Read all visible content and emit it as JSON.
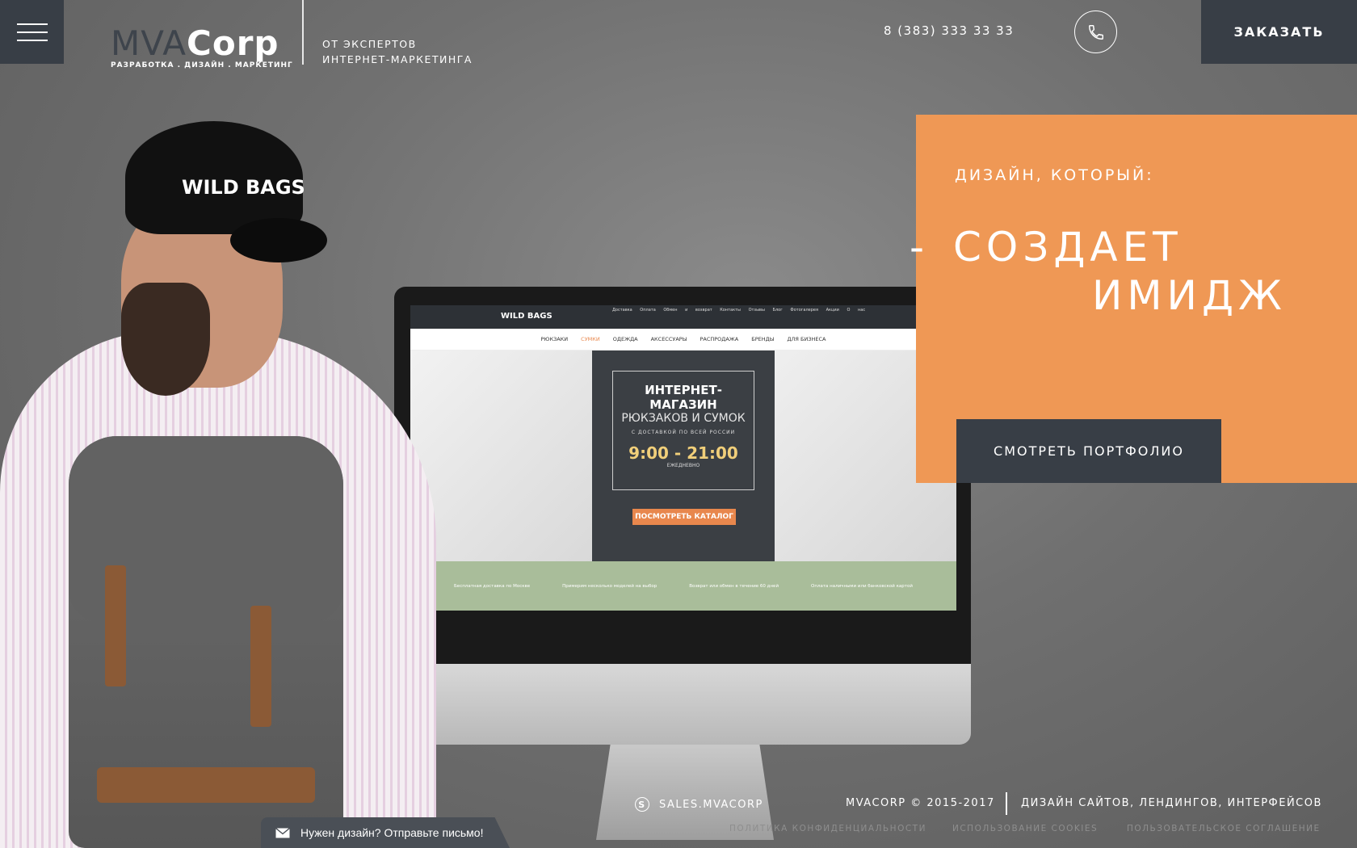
{
  "header": {
    "logo_main_1": "MVA",
    "logo_main_2": "Corp",
    "logo_tagline": "РАЗРАБОТКА . ДИЗАЙН . МАРКЕТИНГ",
    "tagline_line1": "ОТ ЭКСПЕРТОВ",
    "tagline_line2": "ИНТЕРНЕТ-МАРКЕТИНГА",
    "phone": "8 (383) 333 33 33",
    "order_label": "ЗАКАЗАТЬ"
  },
  "promo": {
    "kicker": "ДИЗАЙН, КОТОРЫЙ:",
    "dash": "-",
    "headline_line1": "СОЗДАЕТ",
    "headline_line2": "ИМИДЖ",
    "portfolio_label": "СМОТРЕТЬ ПОРТФОЛИО"
  },
  "hero": {
    "cap_text": "WILD BAGS",
    "site_logo": "WILD BAGS",
    "site_links": "Доставка Оплата Обмен и возврат Контакты Отзывы Блог Фотогалерея Акции О нас",
    "site_nav": [
      "РЮКЗАКИ",
      "СУМКИ",
      "ОДЕЖДА",
      "АКСЕССУАРЫ",
      "РАСПРОДАЖА",
      "БРЕНДЫ",
      "ДЛЯ БИЗНЕСА"
    ],
    "promo_title": "ИНТЕРНЕТ-МАГАЗИН",
    "promo_sub": "РЮКЗАКОВ И СУМОК",
    "promo_small": "С ДОСТАВКОЙ ПО ВСЕЙ РОССИИ",
    "promo_hours": "9:00 - 21:00",
    "promo_daily": "ЕЖЕДНЕВНО",
    "promo_btn": "ПОСМОТРЕТЬ КАТАЛОГ",
    "benefits": [
      "Бесплатная доставка по Москве",
      "Примерим несколько моделей на выбор",
      "Возврат или обмен в течение 60 дней",
      "Оплата наличными или банковской картой"
    ]
  },
  "footer": {
    "skype": "SALES.MVACORP",
    "copyright": "MVACORP © 2015-2017",
    "services": "ДИЗАЙН САЙТОВ, ЛЕНДИНГОВ, ИНТЕРФЕЙСОВ",
    "privacy": "ПОЛИТИКА КОНФИДЕНЦИАЛЬНОСТИ",
    "cookies": "ИСПОЛЬЗОВАНИЕ COOKIES",
    "terms": "ПОЛЬЗОВАТЕЛЬСКОЕ СОГЛАШЕНИЕ"
  },
  "chat": {
    "label": "Нужен дизайн? Отправьте письмо!"
  },
  "colors": {
    "accent": "#ef9855",
    "dark": "#383e46"
  },
  "icons": {
    "menu": "hamburger-icon",
    "call": "phone-icon",
    "skype": "skype-icon",
    "chat": "envelope-icon"
  }
}
